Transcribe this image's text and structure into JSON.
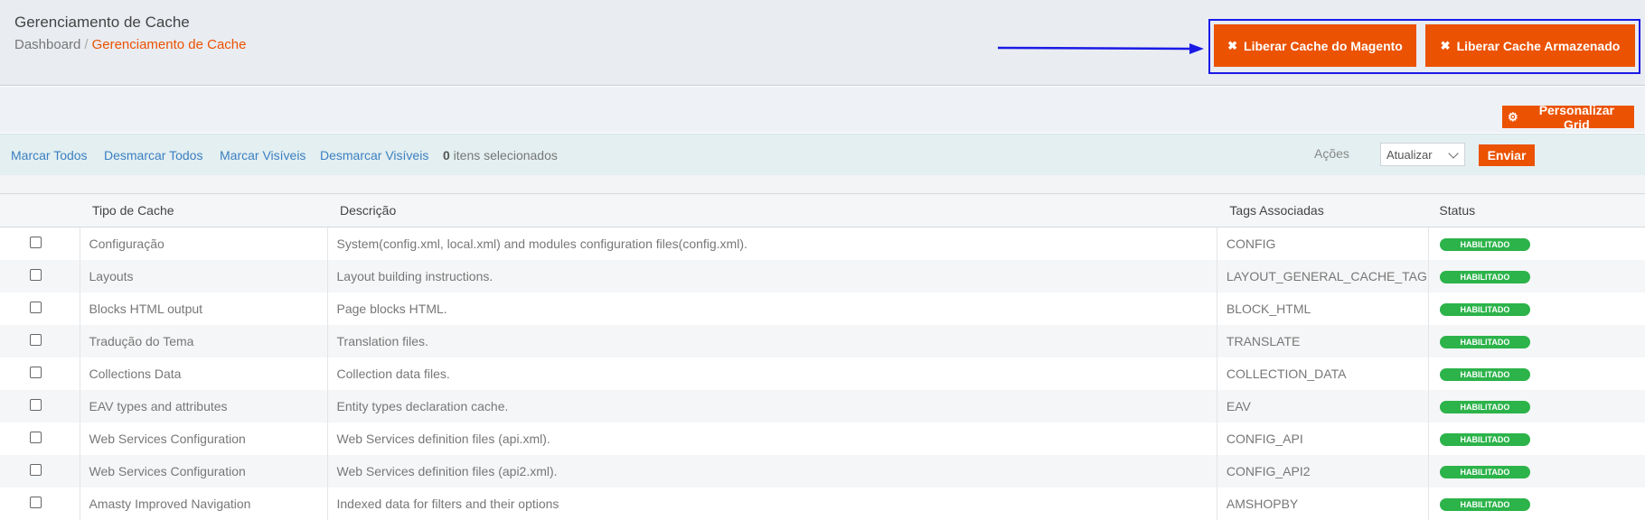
{
  "header": {
    "title": "Gerenciamento de Cache",
    "breadcrumb": {
      "home": "Dashboard",
      "separator": "/",
      "current": "Gerenciamento de Cache"
    }
  },
  "actions": {
    "flush_magento": "Liberar Cache do Magento",
    "flush_storage": "Liberar Cache Armazenado",
    "customize_grid": "Personalizar Grid"
  },
  "massaction": {
    "select_all": "Marcar Todos",
    "unselect_all": "Desmarcar Todos",
    "select_visible": "Marcar Visíveis",
    "unselect_visible": "Desmarcar Visíveis",
    "selected_count": "0",
    "selected_suffix": " itens selecionados",
    "actions_label": "Ações",
    "actions_value": "Atualizar",
    "submit": "Enviar"
  },
  "grid": {
    "columns": {
      "tipo": "Tipo de Cache",
      "descricao": "Descrição",
      "tags": "Tags Associadas",
      "status": "Status"
    },
    "rows": [
      {
        "tipo": "Configuração",
        "descricao": "System(config.xml, local.xml) and modules configuration files(config.xml).",
        "tags": "CONFIG",
        "status": "HABILITADO"
      },
      {
        "tipo": "Layouts",
        "descricao": "Layout building instructions.",
        "tags": "LAYOUT_GENERAL_CACHE_TAG",
        "status": "HABILITADO"
      },
      {
        "tipo": "Blocks HTML output",
        "descricao": "Page blocks HTML.",
        "tags": "BLOCK_HTML",
        "status": "HABILITADO"
      },
      {
        "tipo": "Tradução do Tema",
        "descricao": "Translation files.",
        "tags": "TRANSLATE",
        "status": "HABILITADO"
      },
      {
        "tipo": "Collections Data",
        "descricao": "Collection data files.",
        "tags": "COLLECTION_DATA",
        "status": "HABILITADO"
      },
      {
        "tipo": "EAV types and attributes",
        "descricao": "Entity types declaration cache.",
        "tags": "EAV",
        "status": "HABILITADO"
      },
      {
        "tipo": "Web Services Configuration",
        "descricao": "Web Services definition files (api.xml).",
        "tags": "CONFIG_API",
        "status": "HABILITADO"
      },
      {
        "tipo": "Web Services Configuration",
        "descricao": "Web Services definition files (api2.xml).",
        "tags": "CONFIG_API2",
        "status": "HABILITADO"
      },
      {
        "tipo": "Amasty Improved Navigation",
        "descricao": "Indexed data for filters and their options",
        "tags": "AMSHOPBY",
        "status": "HABILITADO"
      }
    ]
  },
  "colors": {
    "accent": "#eb5202",
    "status_enabled": "#2cb34a",
    "link": "#3c7fc2",
    "highlight_annotation": "#1a1ae6"
  },
  "icons": {
    "flush": "close-icon",
    "customize": "gear-icon",
    "dropdown": "chevron-down-icon",
    "annotation": "arrow-right-icon"
  }
}
